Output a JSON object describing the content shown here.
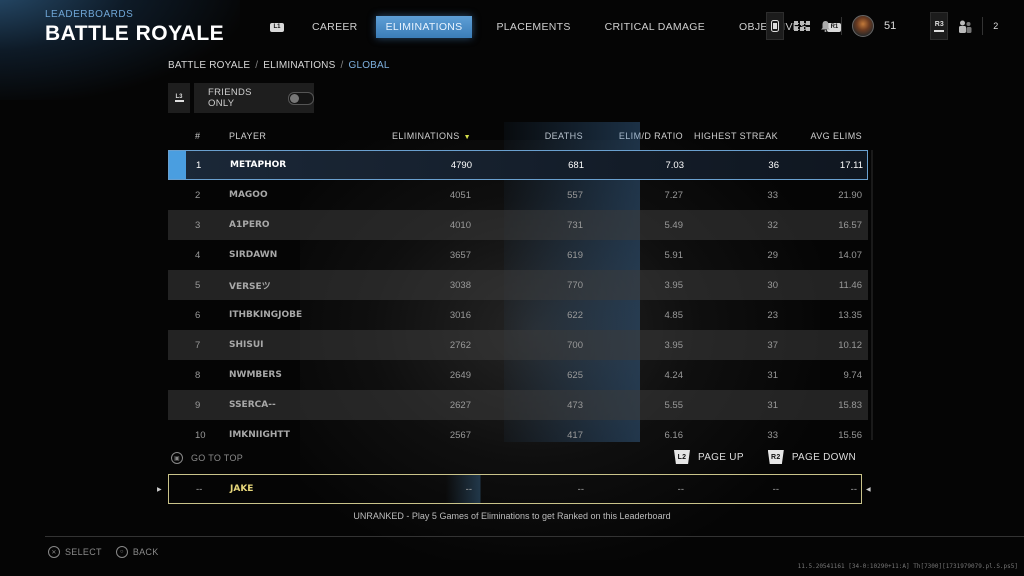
{
  "header": {
    "kicker": "LEADERBOARDS",
    "title": "BATTLE ROYALE"
  },
  "nav": {
    "left_bumper": "L1",
    "right_bumper": "R1",
    "tabs": [
      {
        "label": "CAREER",
        "active": false
      },
      {
        "label": "ELIMINATIONS",
        "active": true
      },
      {
        "label": "PLACEMENTS",
        "active": false
      },
      {
        "label": "CRITICAL DAMAGE",
        "active": false
      },
      {
        "label": "OBJECTIVES",
        "active": false
      }
    ]
  },
  "status": {
    "level": "51",
    "r3_label": "R3",
    "party_count": "2"
  },
  "breadcrumb": [
    "BATTLE ROYALE",
    "ELIMINATIONS",
    "GLOBAL"
  ],
  "filter": {
    "l3_label": "L3",
    "friends_only_label": "FRIENDS ONLY",
    "friends_only_on": false
  },
  "table": {
    "columns": {
      "rank": "#",
      "player": "PLAYER",
      "eliminations": "ELIMINATIONS",
      "deaths": "DEATHS",
      "ratio": "ELIM/D RATIO",
      "streak": "HIGHEST STREAK",
      "avg": "AVG ELIMS"
    },
    "sort_indicator": "▼",
    "rows": [
      {
        "rank": "1",
        "player": "METAPHOR",
        "eliminations": "4790",
        "deaths": "681",
        "ratio": "7.03",
        "streak": "36",
        "avg": "17.11"
      },
      {
        "rank": "2",
        "player": "MAGOO",
        "eliminations": "4051",
        "deaths": "557",
        "ratio": "7.27",
        "streak": "33",
        "avg": "21.90"
      },
      {
        "rank": "3",
        "player": "A1PERO",
        "eliminations": "4010",
        "deaths": "731",
        "ratio": "5.49",
        "streak": "32",
        "avg": "16.57"
      },
      {
        "rank": "4",
        "player": "SIRDAWN",
        "eliminations": "3657",
        "deaths": "619",
        "ratio": "5.91",
        "streak": "29",
        "avg": "14.07"
      },
      {
        "rank": "5",
        "player": "VERSEツ",
        "eliminations": "3038",
        "deaths": "770",
        "ratio": "3.95",
        "streak": "30",
        "avg": "11.46"
      },
      {
        "rank": "6",
        "player": "ITHBKINGJOBE",
        "eliminations": "3016",
        "deaths": "622",
        "ratio": "4.85",
        "streak": "23",
        "avg": "13.35"
      },
      {
        "rank": "7",
        "player": "SHISUI",
        "eliminations": "2762",
        "deaths": "700",
        "ratio": "3.95",
        "streak": "37",
        "avg": "10.12"
      },
      {
        "rank": "8",
        "player": "NWMBERS",
        "eliminations": "2649",
        "deaths": "625",
        "ratio": "4.24",
        "streak": "31",
        "avg": "9.74"
      },
      {
        "rank": "9",
        "player": "SSERCA--",
        "eliminations": "2627",
        "deaths": "473",
        "ratio": "5.55",
        "streak": "31",
        "avg": "15.83"
      },
      {
        "rank": "10",
        "player": "IMKNIIGHTT",
        "eliminations": "2567",
        "deaths": "417",
        "ratio": "6.16",
        "streak": "33",
        "avg": "15.56"
      }
    ]
  },
  "controls": {
    "go_to_top": "GO TO TOP",
    "page_up_button": "L2",
    "page_up": "PAGE UP",
    "page_down_button": "R2",
    "page_down": "PAGE DOWN"
  },
  "my_row": {
    "rank": "--",
    "player": "JAKE",
    "eliminations": "--",
    "deaths": "--",
    "ratio": "--",
    "streak": "--",
    "avg": "--"
  },
  "unranked_message": "UNRANKED - Play 5 Games of Eliminations to get Ranked on this Leaderboard",
  "hints": {
    "select": "SELECT",
    "back": "BACK"
  },
  "build_string": "11.5.20541161 [34-0:10290+11:A] Th[7300][1731979079.pl.S.ps5]",
  "colors": {
    "accent_blue": "#4a9ee0",
    "sort_arrow": "#d6e04a",
    "self_highlight": "#e6d67a"
  }
}
